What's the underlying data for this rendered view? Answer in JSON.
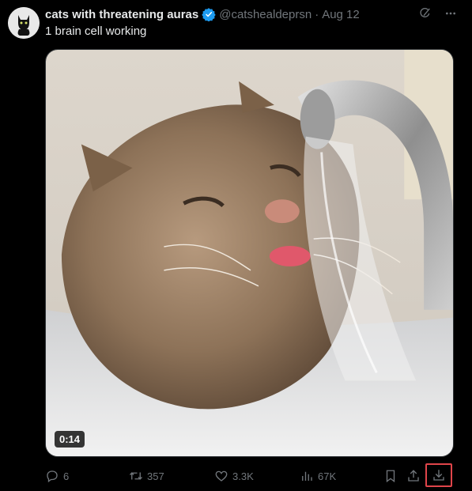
{
  "tweet": {
    "author_name": "cats with threatening auras",
    "handle": "@catshealdeprsn",
    "separator": "·",
    "date": "Aug 12",
    "text": "1 brain cell working",
    "verified_color": "#1d9bf0",
    "video_duration": "0:14"
  },
  "actions": {
    "replies": "6",
    "retweets": "357",
    "likes": "3.3K",
    "views": "67K"
  },
  "icons": {
    "top": [
      "grok-icon",
      "more-icon"
    ],
    "actions": [
      "reply-icon",
      "retweet-icon",
      "like-icon",
      "views-icon",
      "bookmark-icon",
      "share-icon",
      "download-icon"
    ]
  },
  "colors": {
    "background": "#000000",
    "text": "#e7e9ea",
    "muted": "#71767b",
    "highlight_box": "#e0454a"
  }
}
